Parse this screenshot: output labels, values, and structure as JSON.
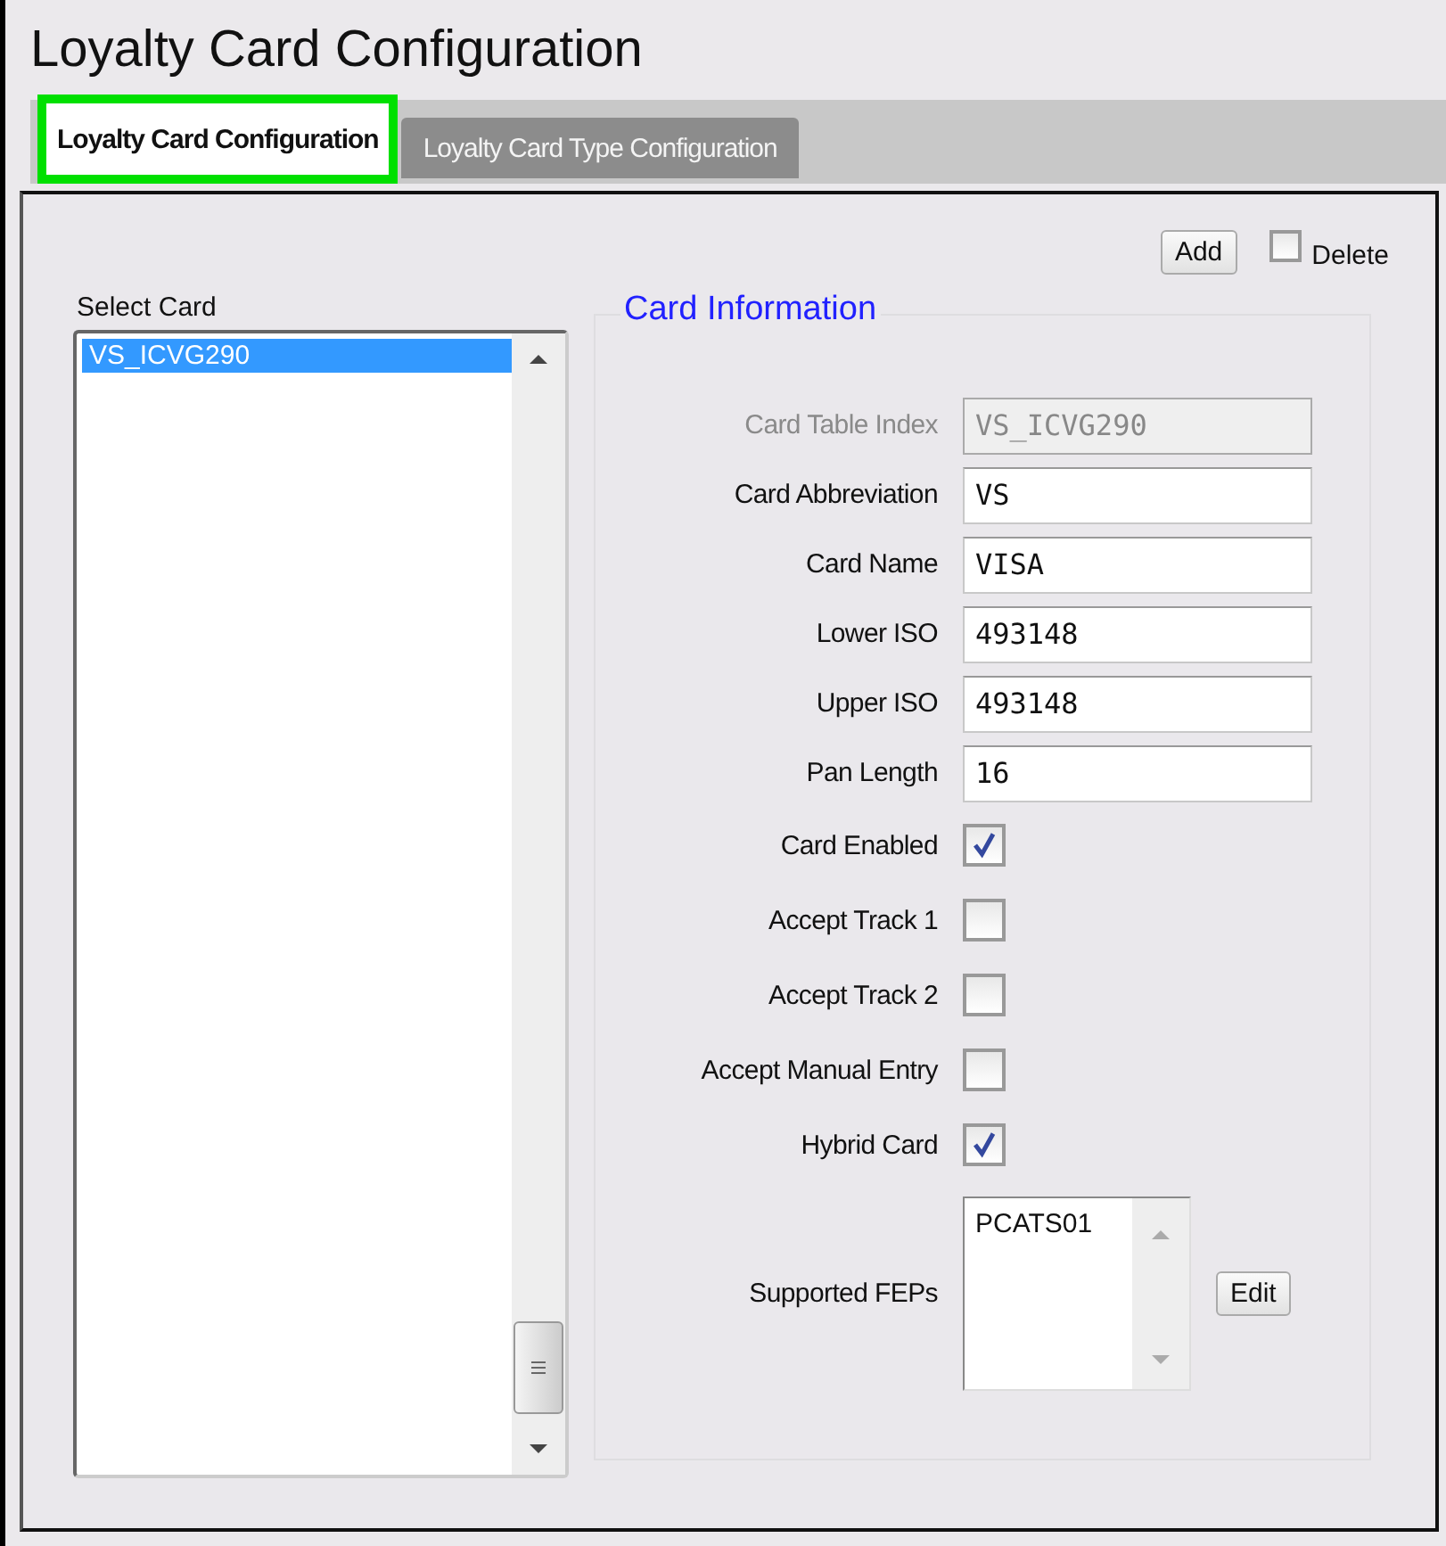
{
  "window": {
    "title": "Loyalty Card Configuration"
  },
  "tabs": [
    {
      "label": "Loyalty Card Configuration",
      "selected": true
    },
    {
      "label": "Loyalty Card Type Configuration",
      "selected": false
    }
  ],
  "toolbar": {
    "add_button": "Add",
    "delete_checkbox": {
      "label": "Delete",
      "checked": false
    }
  },
  "card_list": {
    "label": "Select Card",
    "items": [
      {
        "text": "VS_ICVG290",
        "selected": true
      }
    ]
  },
  "card_information": {
    "title": "Card Information",
    "fields": [
      {
        "kind": "text",
        "label": "Card Table Index",
        "value": "VS_ICVG290",
        "disabled": true
      },
      {
        "kind": "text",
        "label": "Card Abbreviation",
        "value": "VS",
        "disabled": false
      },
      {
        "kind": "text",
        "label": "Card Name",
        "value": "VISA",
        "disabled": false
      },
      {
        "kind": "text",
        "label": "Lower ISO",
        "value": "493148",
        "disabled": false
      },
      {
        "kind": "text",
        "label": "Upper ISO",
        "value": "493148",
        "disabled": false
      },
      {
        "kind": "text",
        "label": "Pan Length",
        "value": "16",
        "disabled": false
      },
      {
        "kind": "checkbox",
        "label": "Card Enabled",
        "checked": true,
        "disabled": false
      },
      {
        "kind": "checkbox",
        "label": "Accept Track 1",
        "checked": false,
        "disabled": false
      },
      {
        "kind": "checkbox",
        "label": "Accept Track 2",
        "checked": false,
        "disabled": false
      },
      {
        "kind": "checkbox",
        "label": "Accept Manual Entry",
        "checked": false,
        "disabled": false
      },
      {
        "kind": "checkbox",
        "label": "Hybrid Card",
        "checked": true,
        "disabled": false
      },
      {
        "kind": "list",
        "label": "Supported FEPs",
        "items": [
          "PCATS01"
        ],
        "button": "Edit",
        "disabled": false
      }
    ]
  }
}
